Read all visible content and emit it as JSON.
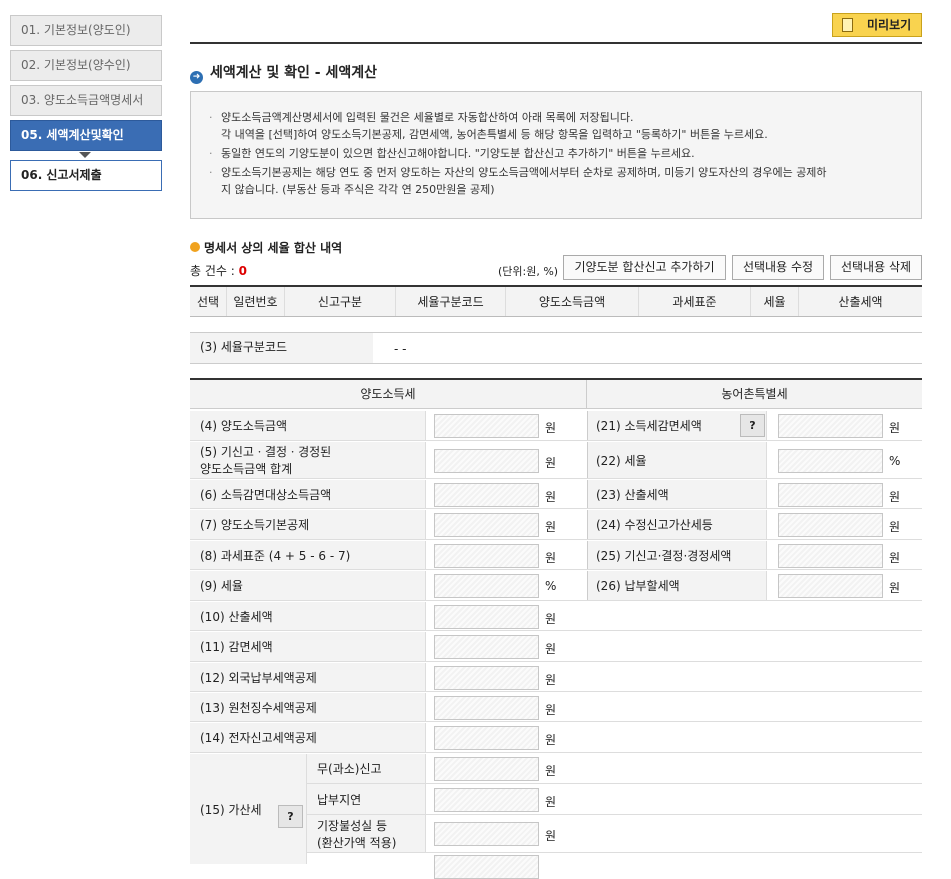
{
  "sidebar": {
    "steps": [
      "01. 기본정보(양도인)",
      "02. 기본정보(양수인)",
      "03. 양도소득금액명세서",
      "05. 세액계산및확인",
      "06. 신고서제출"
    ]
  },
  "preview_label": "미리보기",
  "section_title": "세액계산 및 확인 - 세액계산",
  "notices": [
    "양도소득금액계산명세서에 입력된 물건은 세율별로 자동합산하여 아래 목록에 저장됩니다.",
    "각 내역을 [선택]하여 양도소득기본공제, 감면세액, 농어촌특별세 등 해당 항목을 입력하고 \"등록하기\" 버튼을 누르세요.",
    "동일한 연도의 기양도분이 있으면 합산신고해야합니다. \"기양도분 합산신고 추가하기\" 버튼을 누르세요.",
    "양도소득기본공제는 해당 연도 중 먼저 양도하는 자산의 양도소득금액에서부터 순차로 공제하며, 미등기 양도자산의 경우에는 공제하",
    "지 않습니다. (부동산 등과 주식은 각각 연 250만원을 공제)"
  ],
  "sub_title": "명세서 상의 세율 합산 내역",
  "total_label": "총 건수 : ",
  "total_count": "0",
  "unit_note": "(단위:원, %)",
  "buttons": {
    "add": "기양도분 합산신고 추가하기",
    "edit": "선택내용 수정",
    "delete": "선택내용 삭제"
  },
  "table_headers": [
    "선택",
    "일련번호",
    "신고구분",
    "세율구분코드",
    "양도소득금액",
    "과세표준",
    "세율",
    "산출세액"
  ],
  "rate_code": {
    "label": "(3) 세율구분코드",
    "value": "-   -"
  },
  "grid": {
    "left_header": "양도소득세",
    "right_header": "농어촌특별세",
    "left_rows": [
      {
        "label": "(4) 양도소득금액",
        "unit": "원"
      },
      {
        "label": "(5) 기신고ㆍ결정ㆍ경정된\n양도소득금액 합계",
        "unit": "원"
      },
      {
        "label": "(6) 소득감면대상소득금액",
        "unit": "원"
      },
      {
        "label": "(7) 양도소득기본공제",
        "unit": "원"
      },
      {
        "label": "(8) 과세표준 (4 + 5 - 6 - 7)",
        "unit": "원"
      },
      {
        "label": "(9) 세율",
        "unit": "%"
      },
      {
        "label": "(10) 산출세액",
        "unit": "원"
      },
      {
        "label": "(11) 감면세액",
        "unit": "원"
      },
      {
        "label": "(12) 외국납부세액공제",
        "unit": "원"
      },
      {
        "label": "(13) 원천징수세액공제",
        "unit": "원"
      },
      {
        "label": "(14) 전자신고세액공제",
        "unit": "원"
      }
    ],
    "right_rows": [
      {
        "label": "(21) 소득세감면세액",
        "unit": "원",
        "help": "?"
      },
      {
        "label": "(22) 세율",
        "unit": "%"
      },
      {
        "label": "(23) 산출세액",
        "unit": "원"
      },
      {
        "label": "(24) 수정신고가산세등",
        "unit": "원"
      },
      {
        "label": "(25) 기신고·결정·경정세액",
        "unit": "원"
      },
      {
        "label": "(26) 납부할세액",
        "unit": "원"
      }
    ],
    "penalty": {
      "label": "(15) 가산세",
      "help": "?",
      "items": [
        {
          "label": "무(과소)신고",
          "unit": "원"
        },
        {
          "label": "납부지연",
          "unit": "원"
        },
        {
          "label": "기장불성실 등\n(환산가액 적용)",
          "unit": "원"
        }
      ]
    }
  }
}
